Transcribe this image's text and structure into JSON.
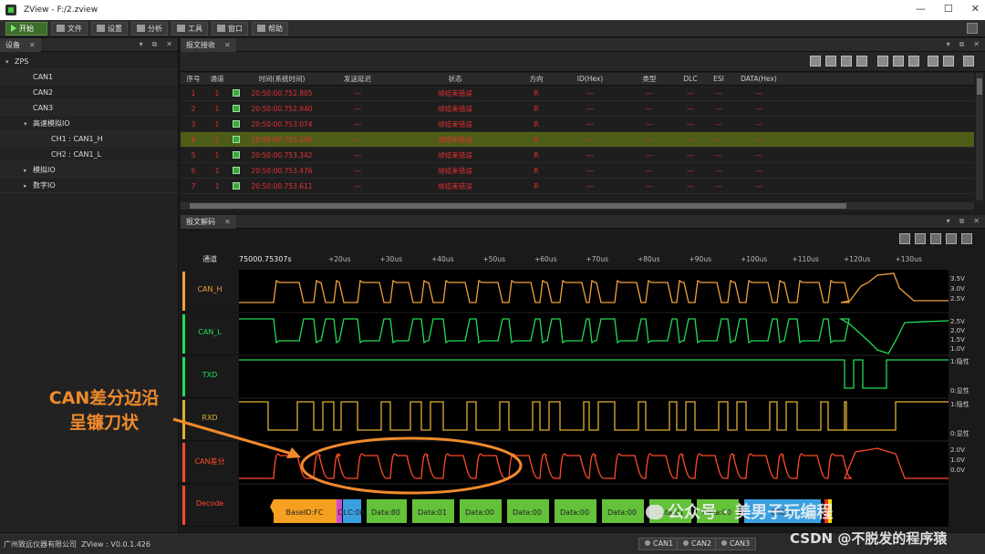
{
  "window": {
    "title": "ZView - F:/2.zview",
    "controls": [
      "—",
      "☐",
      "✕"
    ]
  },
  "toolbar": {
    "start": "开始",
    "file": "文件",
    "settings": "设置",
    "analysis": "分析",
    "tools": "工具",
    "window": "窗口",
    "help": "帮助"
  },
  "device_panel": {
    "tab": "设备",
    "tree": [
      {
        "label": "ZPS",
        "level": 0,
        "caret": "▾"
      },
      {
        "label": "CAN1",
        "level": 1,
        "caret": ""
      },
      {
        "label": "CAN2",
        "level": 1,
        "caret": ""
      },
      {
        "label": "CAN3",
        "level": 1,
        "caret": ""
      },
      {
        "label": "高速模拟IO",
        "level": 1,
        "caret": "▾"
      },
      {
        "label": "CH1 : CAN1_H",
        "level": 2,
        "caret": ""
      },
      {
        "label": "CH2 : CAN1_L",
        "level": 2,
        "caret": ""
      },
      {
        "label": "模拟IO",
        "level": 1,
        "caret": "▸"
      },
      {
        "label": "数字IO",
        "level": 1,
        "caret": "▸"
      }
    ]
  },
  "message_panel": {
    "tab": "报文接收",
    "columns": [
      "序号",
      "通道",
      "",
      "时间(系统时间)",
      "发送延迟",
      "状态",
      "方向",
      "ID(Hex)",
      "类型",
      "DLC",
      "ESI",
      "DATA(Hex)"
    ],
    "rows": [
      {
        "idx": "1",
        "ch": "1",
        "time": "20:50:00.752.805",
        "delay": "---",
        "status": "帧结束错误",
        "dir": "R",
        "id": "---",
        "type": "---",
        "dlc": "---",
        "esi": "---",
        "data": "---"
      },
      {
        "idx": "2",
        "ch": "1",
        "time": "20:50:00.752.940",
        "delay": "---",
        "status": "帧结束错误",
        "dir": "R",
        "id": "---",
        "type": "---",
        "dlc": "---",
        "esi": "---",
        "data": "---"
      },
      {
        "idx": "3",
        "ch": "1",
        "time": "20:50:00.753.074",
        "delay": "---",
        "status": "帧结束错误",
        "dir": "R",
        "id": "---",
        "type": "---",
        "dlc": "---",
        "esi": "---",
        "data": "---"
      },
      {
        "idx": "4",
        "ch": "1",
        "time": "20:50:00.753.208",
        "delay": "---",
        "status": "帧结束错误",
        "dir": "R",
        "id": "---",
        "type": "---",
        "dlc": "---",
        "esi": "---",
        "data": "---"
      },
      {
        "idx": "5",
        "ch": "1",
        "time": "20:50:00.753.342",
        "delay": "---",
        "status": "帧结束错误",
        "dir": "R",
        "id": "---",
        "type": "---",
        "dlc": "---",
        "esi": "---",
        "data": "---"
      },
      {
        "idx": "6",
        "ch": "1",
        "time": "20:50:00.753.476",
        "delay": "---",
        "status": "帧结束错误",
        "dir": "R",
        "id": "---",
        "type": "---",
        "dlc": "---",
        "esi": "---",
        "data": "---"
      },
      {
        "idx": "7",
        "ch": "1",
        "time": "20:50:00.753.611",
        "delay": "---",
        "status": "帧结束错误",
        "dir": "R",
        "id": "---",
        "type": "---",
        "dlc": "---",
        "esi": "---",
        "data": "---"
      }
    ],
    "highlight_row": 3
  },
  "decode_panel": {
    "tab": "报文解码",
    "channel_header": "通道",
    "time_origin": "75000.75307s",
    "ticks": [
      "+20us",
      "+30us",
      "+40us",
      "+50us",
      "+60us",
      "+70us",
      "+80us",
      "+90us",
      "+100us",
      "+110us",
      "+120us",
      "+130us"
    ],
    "channels": [
      {
        "name": "CAN_H",
        "color": "#f2a13a",
        "scale": [
          "3.5V",
          "3.0V",
          "2.5V"
        ]
      },
      {
        "name": "CAN_L",
        "color": "#22dd55",
        "scale": [
          "2.5V",
          "2.0V",
          "1.5V",
          "1.0V"
        ]
      },
      {
        "name": "TXD",
        "color": "#22dd55",
        "scale": [
          "1:隐性",
          "0:显性"
        ]
      },
      {
        "name": "RXD",
        "color": "#e0b030",
        "scale": [
          "1:隐性",
          "0:显性"
        ]
      },
      {
        "name": "CAN差分",
        "color": "#ff4a2a",
        "scale": [
          "2.0V",
          "1.0V",
          "0.0V"
        ]
      },
      {
        "name": "Decode",
        "color": "#ff4a2a",
        "scale": []
      }
    ],
    "decode_segments": [
      {
        "label": "BaseID:FC",
        "color": "#f5a020"
      },
      {
        "label": "DLC:08",
        "color": "#3aa0e0"
      },
      {
        "label": "Data:80",
        "color": "#63c13a"
      },
      {
        "label": "Data:01",
        "color": "#63c13a"
      },
      {
        "label": "Data:00",
        "color": "#63c13a"
      },
      {
        "label": "Data:00",
        "color": "#63c13a"
      },
      {
        "label": "Data:00",
        "color": "#63c13a"
      },
      {
        "label": "Data:00",
        "color": "#63c13a"
      },
      {
        "label": "Data:01",
        "color": "#63c13a"
      },
      {
        "label": "Data:00",
        "color": "#63c13a"
      },
      {
        "label": "CRC:1",
        "color": "#3aa0e0"
      }
    ]
  },
  "annotation": {
    "line1": "CAN差分边沿",
    "line2": "呈镰刀状"
  },
  "status_bar": {
    "company": "广州致远仪器有限公司",
    "version": "ZView : V0.0.1.426",
    "tabs": [
      "CAN1",
      "CAN2",
      "CAN3"
    ]
  },
  "watermark": {
    "line1": "公众号 · 美男子玩编程",
    "line2": "CSDN @不脱发的程序猿"
  }
}
